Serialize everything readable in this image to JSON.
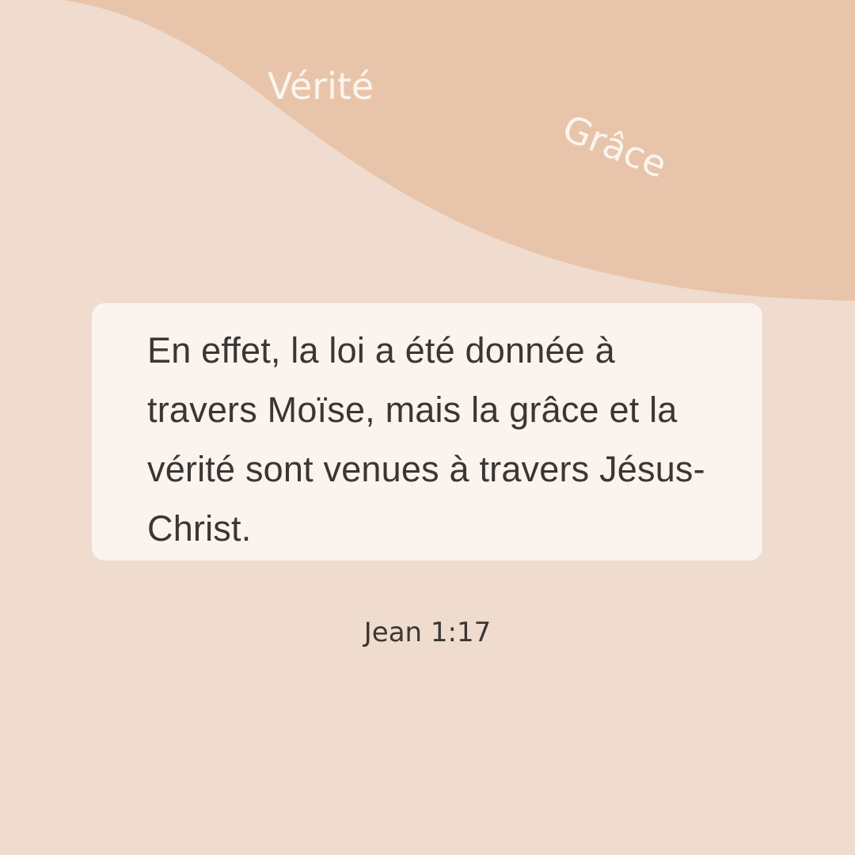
{
  "colors": {
    "background": "#efdccf",
    "wave": "#e8c5aa",
    "card": "#faf3ee",
    "text": "#3a3633",
    "accent_text": "#fbf5ef"
  },
  "decor": {
    "words": [
      {
        "text": "Vérité"
      },
      {
        "text": "Grâce"
      }
    ]
  },
  "quote": {
    "text": "En effet, la loi a été donnée à travers Moïse, mais la grâce et la vérité sont venues à travers Jésus-Christ."
  },
  "reference": {
    "text": "Jean 1:17"
  }
}
